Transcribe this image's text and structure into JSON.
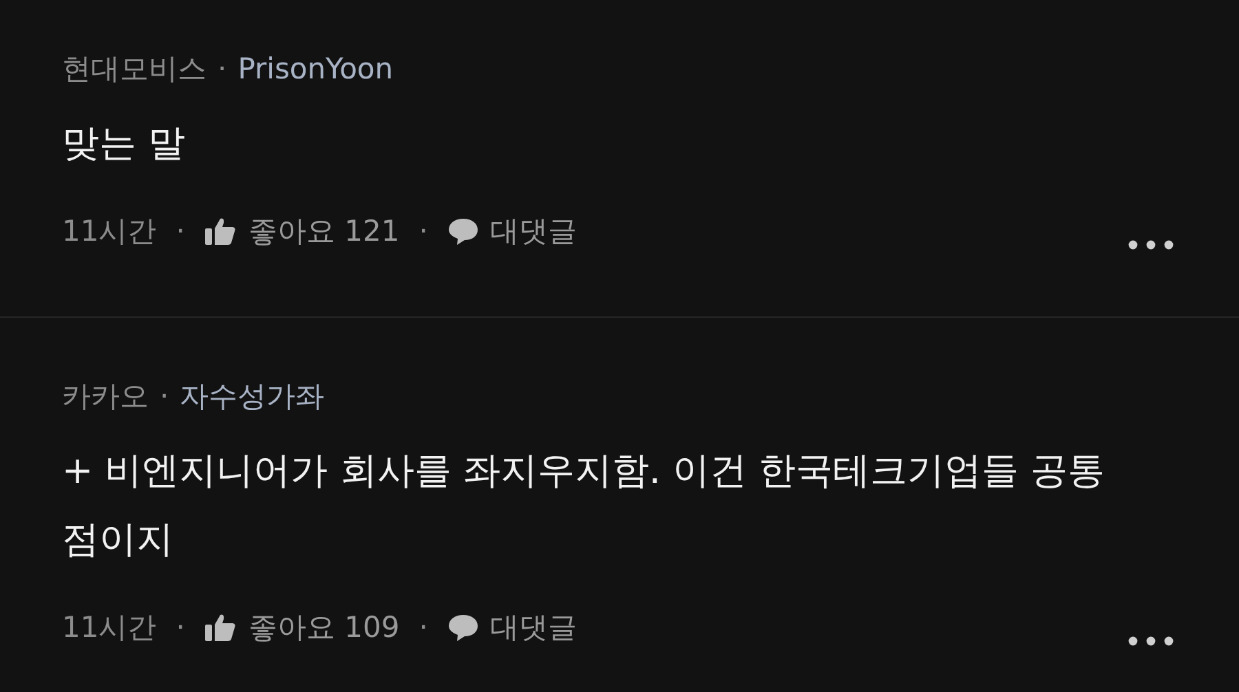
{
  "comments": [
    {
      "company": "현대모비스",
      "header_separator": "·",
      "author": "PrisonYoon",
      "body": "맞는 말",
      "time": "11시간",
      "meta_separators": [
        "·",
        "·"
      ],
      "like_label": "좋아요",
      "likes": "121",
      "reply_label": "대댓글"
    },
    {
      "company": "카카오",
      "header_separator": "·",
      "author": "자수성가좌",
      "body": "+ 비엔지니어가 회사를 좌지우지함. 이건 한국테크기업들 공통점이지",
      "time": "11시간",
      "meta_separators": [
        "·",
        "·"
      ],
      "like_label": "좋아요",
      "likes": "109",
      "reply_label": "대댓글"
    }
  ]
}
